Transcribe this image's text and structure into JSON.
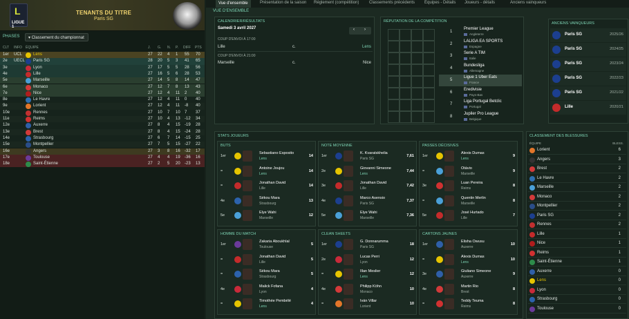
{
  "banner": {
    "title": "TENANTS DU TITRE",
    "subtitle": "Paris SG",
    "logo_text": "LIGUE 1"
  },
  "left": {
    "phases_label": "PHASES",
    "select_label": "Classement du championnat"
  },
  "table_headers": [
    "CLT",
    "INFO",
    "ÉQUIPE",
    "J.",
    "G.",
    "N.",
    "P.",
    "DIFF",
    "PTS"
  ],
  "standings": [
    [
      "1er",
      "UCL",
      "Lens",
      "27",
      "22",
      "4",
      "1",
      "55",
      "70"
    ],
    [
      "2e",
      "UECL",
      "Paris SG",
      "28",
      "20",
      "5",
      "3",
      "41",
      "65"
    ],
    [
      "3e",
      "",
      "Lyon",
      "27",
      "17",
      "5",
      "5",
      "28",
      "56"
    ],
    [
      "4e",
      "",
      "Lille",
      "27",
      "16",
      "5",
      "6",
      "28",
      "53"
    ],
    [
      "5e",
      "",
      "Marseille",
      "27",
      "14",
      "5",
      "8",
      "14",
      "47"
    ],
    [
      "6e",
      "",
      "Monaco",
      "27",
      "12",
      "7",
      "8",
      "13",
      "43"
    ],
    [
      "7e",
      "",
      "Nice",
      "27",
      "12",
      "4",
      "11",
      "2",
      "40"
    ],
    [
      "8e",
      "",
      "Le Havre",
      "27",
      "12",
      "4",
      "11",
      "0",
      "40"
    ],
    [
      "9e",
      "",
      "Lorient",
      "27",
      "12",
      "4",
      "11",
      "-8",
      "40"
    ],
    [
      "10e",
      "",
      "Rennes",
      "27",
      "10",
      "7",
      "10",
      "7",
      "37"
    ],
    [
      "11e",
      "",
      "Reims",
      "27",
      "10",
      "4",
      "13",
      "-12",
      "34"
    ],
    [
      "12e",
      "",
      "Auxerre",
      "27",
      "8",
      "4",
      "15",
      "-19",
      "28"
    ],
    [
      "13e",
      "",
      "Brest",
      "27",
      "8",
      "4",
      "15",
      "-24",
      "28"
    ],
    [
      "14e",
      "",
      "Strasbourg",
      "27",
      "6",
      "7",
      "14",
      "-15",
      "25"
    ],
    [
      "15e",
      "",
      "Montpellier",
      "27",
      "7",
      "5",
      "15",
      "-27",
      "22"
    ],
    [
      "16e",
      "",
      "Angers",
      "27",
      "3",
      "8",
      "16",
      "-32",
      "17"
    ],
    [
      "17e",
      "",
      "Toulouse",
      "27",
      "4",
      "4",
      "19",
      "-36",
      "16"
    ],
    [
      "18e",
      "",
      "Saint-Étienne",
      "27",
      "2",
      "5",
      "20",
      "-23",
      "13"
    ]
  ],
  "tabs": [
    "Vue d'ensemble",
    "Présentation de la saison",
    "Réglement (compétition)",
    "Classements précédents",
    "Équipes - Détails",
    "Joueurs - détails",
    "Anciens vainqueurs"
  ],
  "section_overview": "VUE D'ENSEMBLE",
  "calendar": {
    "title": "CALENDRIER/RÉSULTATS",
    "date": "Samedi 3 avril 2027",
    "matches": [
      {
        "kickoff": "COUP D'ENVOI À 17:00",
        "home": "Lille",
        "sep": "c.",
        "away": "Lens"
      },
      {
        "kickoff": "COUP D'ENVOI À 21:00",
        "home": "Marseille",
        "sep": "c.",
        "away": "Nice"
      }
    ]
  },
  "reputation": {
    "title": "RÉPUTATION DE LA COMPÉTITION",
    "leagues": [
      {
        "rank": "1",
        "name": "Premier League",
        "country": "Angleterre"
      },
      {
        "rank": "2",
        "name": "LALIGA EA SPORTS",
        "country": "Espagne"
      },
      {
        "rank": "3",
        "name": "Serie A TIM",
        "country": "Italie"
      },
      {
        "rank": "4",
        "name": "Bundesliga",
        "country": "Allemagne"
      },
      {
        "rank": "5",
        "name": "Ligue 1 Uber Eats",
        "country": "France"
      },
      {
        "rank": "6",
        "name": "Eredivisie",
        "country": "Pays-Bas"
      },
      {
        "rank": "7",
        "name": "Liga Portugal Betclic",
        "country": "Portugal"
      },
      {
        "rank": "8",
        "name": "Jupiler Pro League",
        "country": "Belgique"
      }
    ]
  },
  "winners": {
    "title": "ANCIENS VAINQUEURS",
    "rows": [
      [
        "Paris SG",
        "2025/26"
      ],
      [
        "Paris SG",
        "2024/25"
      ],
      [
        "Paris SG",
        "2023/24"
      ],
      [
        "Paris SG",
        "2022/23"
      ],
      [
        "Paris SG",
        "2021/22"
      ],
      [
        "Lille",
        "2020/21"
      ]
    ]
  },
  "stats_title": "STATS JOUEURS",
  "stat_panels": [
    {
      "title": "BUTS",
      "rows": [
        [
          "1er",
          "Sebastiano Esposito",
          "Lens",
          "14"
        ],
        [
          "=",
          "Antoine Joujou",
          "Lens",
          "14"
        ],
        [
          "=",
          "Jonathan David",
          "Lille",
          "14"
        ],
        [
          "4e",
          "Sékou Mara",
          "Strasbourg",
          "13"
        ],
        [
          "5e",
          "Elye Wahi",
          "Marseille",
          "12"
        ]
      ]
    },
    {
      "title": "NOTE MOYENNE",
      "rows": [
        [
          "1er",
          "K. Kvaratskhelia",
          "Paris SG",
          "7,61"
        ],
        [
          "2e",
          "Giovanni Simeone",
          "Lens",
          "7,44"
        ],
        [
          "3e",
          "Jonathan David",
          "Lille",
          "7,42"
        ],
        [
          "4e",
          "Marco Asensio",
          "Paris SG",
          "7,37"
        ],
        [
          "5e",
          "Elye Wahi",
          "Marseille",
          "7,36"
        ]
      ]
    },
    {
      "title": "PASSES DÉCISIVES",
      "rows": [
        [
          "1er",
          "Alexis Dumas",
          "Lens",
          "9"
        ],
        [
          "=",
          "Otávio",
          "Marseille",
          "9"
        ],
        [
          "3e",
          "Luan Pereira",
          "Reims",
          "8"
        ],
        [
          "=",
          "Quentin Merlin",
          "Marseille",
          "8"
        ],
        [
          "5e",
          "José Hurtado",
          "Lille",
          "7"
        ]
      ]
    },
    {
      "title": "HOMME DU MATCH",
      "rows": [
        [
          "1er",
          "Zakaria Aboukhlal",
          "Toulouse",
          "5"
        ],
        [
          "=",
          "Jonathan David",
          "Lille",
          "5"
        ],
        [
          "=",
          "Sékou Mara",
          "Strasbourg",
          "5"
        ],
        [
          "4e",
          "Malick Fofana",
          "Lyon",
          "4"
        ],
        [
          "=",
          "Timothée Pembélé",
          "Lens",
          "4"
        ]
      ]
    },
    {
      "title": "CLEAN SHEETS",
      "rows": [
        [
          "1er",
          "G. Donnarumma",
          "Paris SG",
          "18"
        ],
        [
          "2e",
          "Lucas Perri",
          "Lyon",
          "12"
        ],
        [
          "=",
          "Illan Meslier",
          "Lens",
          "12"
        ],
        [
          "4e",
          "Philipp Köhn",
          "Monaco",
          "10"
        ],
        [
          "=",
          "Iván Villar",
          "Lorient",
          "10"
        ]
      ]
    },
    {
      "title": "CARTONS JAUNES",
      "rows": [
        [
          "1er",
          "Elisha Owusu",
          "Auxerre",
          "10"
        ],
        [
          "=",
          "Alexis Dumas",
          "Lens",
          "10"
        ],
        [
          "3e",
          "Giuliano Simeone",
          "Auxerre",
          "9"
        ],
        [
          "4e",
          "Martin Rio",
          "Brest",
          "8"
        ],
        [
          "=",
          "Teddy Teuma",
          "Reims",
          "8"
        ]
      ]
    }
  ],
  "injuries": {
    "title": "CLASSEMENT DES BLESSURES",
    "col_team": "ÉQUIPE",
    "col_count": "BLESS.",
    "rows": [
      [
        "Lorient",
        "6"
      ],
      [
        "Angers",
        "3"
      ],
      [
        "Brest",
        "2"
      ],
      [
        "Le Havre",
        "2"
      ],
      [
        "Marseille",
        "2"
      ],
      [
        "Monaco",
        "2"
      ],
      [
        "Montpellier",
        "2"
      ],
      [
        "Paris SG",
        "2"
      ],
      [
        "Rennes",
        "2"
      ],
      [
        "Lille",
        "1"
      ],
      [
        "Nice",
        "1"
      ],
      [
        "Reims",
        "1"
      ],
      [
        "Saint-Étienne",
        "1"
      ],
      [
        "Auxerre",
        "0"
      ],
      [
        "Lens",
        "0"
      ],
      [
        "Lyon",
        "0"
      ],
      [
        "Strasbourg",
        "0"
      ],
      [
        "Toulouse",
        "0"
      ]
    ]
  },
  "colors": {
    "accent": "#7fd6b6",
    "lens": "#e6c400",
    "champion": "#2f6e5a",
    "europa": "#224840",
    "relegation": "#5a2020"
  }
}
